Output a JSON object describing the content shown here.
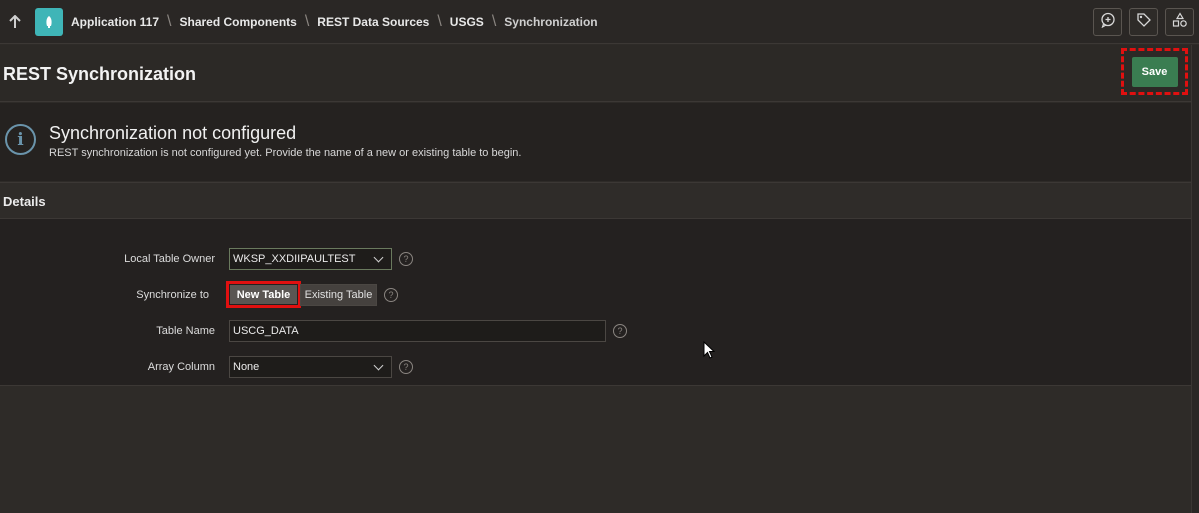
{
  "breadcrumb": {
    "items": [
      "Application 117",
      "Shared Components",
      "REST Data Sources",
      "USGS",
      "Synchronization"
    ]
  },
  "header": {
    "title": "REST Synchronization",
    "save_label": "Save"
  },
  "alert": {
    "title": "Synchronization not configured",
    "text": "REST synchronization is not configured yet. Provide the name of a new or existing table to begin."
  },
  "details": {
    "title": "Details",
    "fields": {
      "owner": {
        "label": "Local Table Owner",
        "value": "WKSP_XXDIIPAULTEST"
      },
      "sync_to": {
        "label": "Synchronize to",
        "options": [
          "New Table",
          "Existing Table"
        ],
        "selected": "New Table"
      },
      "table_name": {
        "label": "Table Name",
        "value": "USCG_DATA"
      },
      "array_column": {
        "label": "Array Column",
        "value": "None"
      }
    }
  },
  "icons": {
    "up": "arrow-up-icon",
    "app": "app-icon",
    "feedback": "feedback-icon",
    "tag": "tag-icon",
    "shapes": "shared-components-icon",
    "info": "info-icon",
    "help": "help-icon"
  },
  "colors": {
    "accent": "#3fb5b7",
    "save": "#3a7d51",
    "highlight": "#e01010",
    "info": "#6a94ab"
  }
}
